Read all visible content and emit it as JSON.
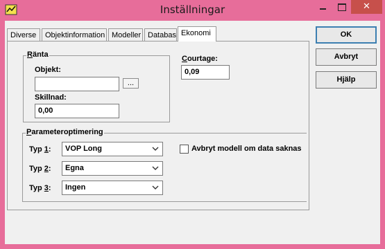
{
  "window": {
    "title": "Inställningar"
  },
  "tabs": [
    {
      "label": "Diverse"
    },
    {
      "label": "Objektinformation"
    },
    {
      "label": "Modeller"
    },
    {
      "label": "Databas"
    },
    {
      "label": "Ekonomi"
    }
  ],
  "ranta": {
    "legend_first": "R",
    "legend_rest": "änta",
    "objekt_label": "Objekt:",
    "objekt_value": "",
    "browse_label": "...",
    "skillnad_label": "Skillnad:",
    "skillnad_value": "0,00"
  },
  "courtage": {
    "label_first": "C",
    "label_rest": "ourtage:",
    "value": "0,09"
  },
  "param": {
    "legend_first": "P",
    "legend_rest": "arameteroptimering",
    "typ1": {
      "label": "Typ ",
      "num": "1",
      "colon": ":",
      "value": "VOP Long"
    },
    "typ2": {
      "label": "Typ ",
      "num": "2",
      "colon": ":",
      "value": "Egna"
    },
    "typ3": {
      "label": "Typ ",
      "num": "3",
      "colon": ":",
      "value": "Ingen"
    },
    "abort_label": "Avbryt modell om data saknas"
  },
  "buttons": {
    "ok": "OK",
    "cancel": "Avbryt",
    "help": "Hjälp"
  },
  "titlebar": {
    "close_glyph": "✕"
  }
}
